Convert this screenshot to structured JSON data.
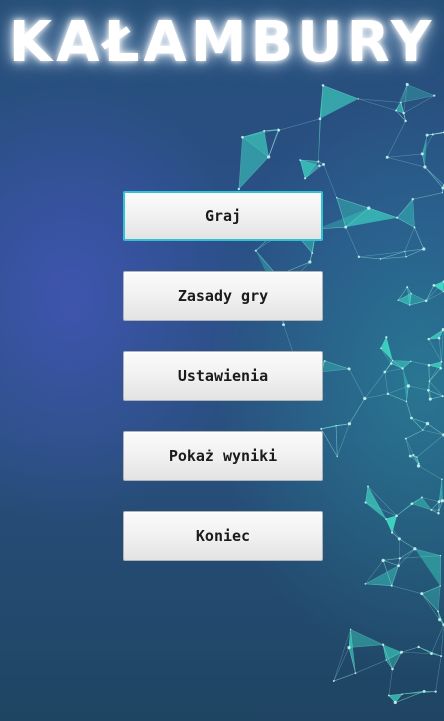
{
  "title": "KAŁAMBURY",
  "menu": {
    "items": [
      {
        "label": "Graj",
        "focused": true
      },
      {
        "label": "Zasady gry",
        "focused": false
      },
      {
        "label": "Ustawienia",
        "focused": false
      },
      {
        "label": "Pokaż wyniki",
        "focused": false
      },
      {
        "label": "Koniec",
        "focused": false
      }
    ]
  },
  "colors": {
    "background_dark": "#274f78",
    "background_glow": "#5a5ad2",
    "network_accent": "#3fe0c8",
    "button_face": "#f1f1f1",
    "focus_border": "#32c2d6",
    "button_text": "#1b1b1b"
  }
}
